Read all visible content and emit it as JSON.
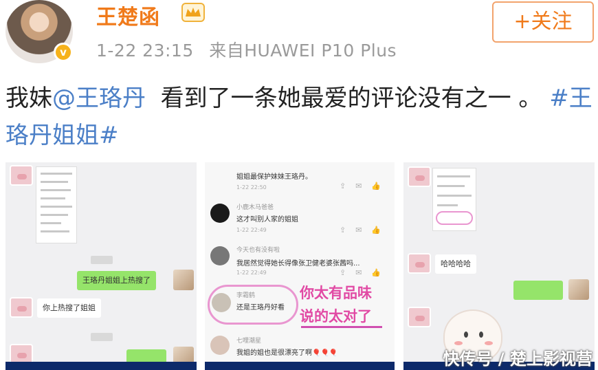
{
  "header": {
    "name": "王楚函",
    "timestamp": "1-22 23:15",
    "source": "来自HUAWEI P10 Plus",
    "follow_label": "+关注",
    "verified_mark": "v"
  },
  "post": {
    "prefix": "我妹",
    "mention": "@王珞丹",
    "body": "  看到了一条她最爱的评论没有之一 。 ",
    "hashtag": "#王珞丹姐姐#"
  },
  "screenshots": {
    "left": {
      "bubble_sent": "王珞丹姐姐上热搜了",
      "bubble_received": "你上热搜了姐姐"
    },
    "middle": {
      "top_text": "姐姐最保护妹妹王珞丹。",
      "top_time": "1-22 22:50",
      "comments": [
        {
          "user": "小鹿木马爸爸",
          "text": "这才叫别人家的姐姐",
          "time": "1-22 22:49"
        },
        {
          "user": "今天也有没有啦",
          "text": "我居然觉得她长得像张卫健老婆张茜吗...",
          "time": "1-22 22:49"
        },
        {
          "user": "李霜鹤",
          "text": "还是王珞丹好看",
          "time": ""
        },
        {
          "user": "七哩潮星",
          "text": "我姐的姐也是很漂亮了啊🎈🎈🎈",
          "time": ""
        }
      ],
      "annotation_line1": "你太有品味",
      "annotation_line2": "说的太对了"
    },
    "right": {
      "bubble_received": "哈哈哈哈"
    }
  },
  "watermark": "快传号 / 楚上影视营",
  "colors": {
    "name_orange": "#f07a1a",
    "link_blue": "#4b7fc7",
    "annotation_pink": "#e14aa4",
    "wechat_green": "#95e46a"
  }
}
